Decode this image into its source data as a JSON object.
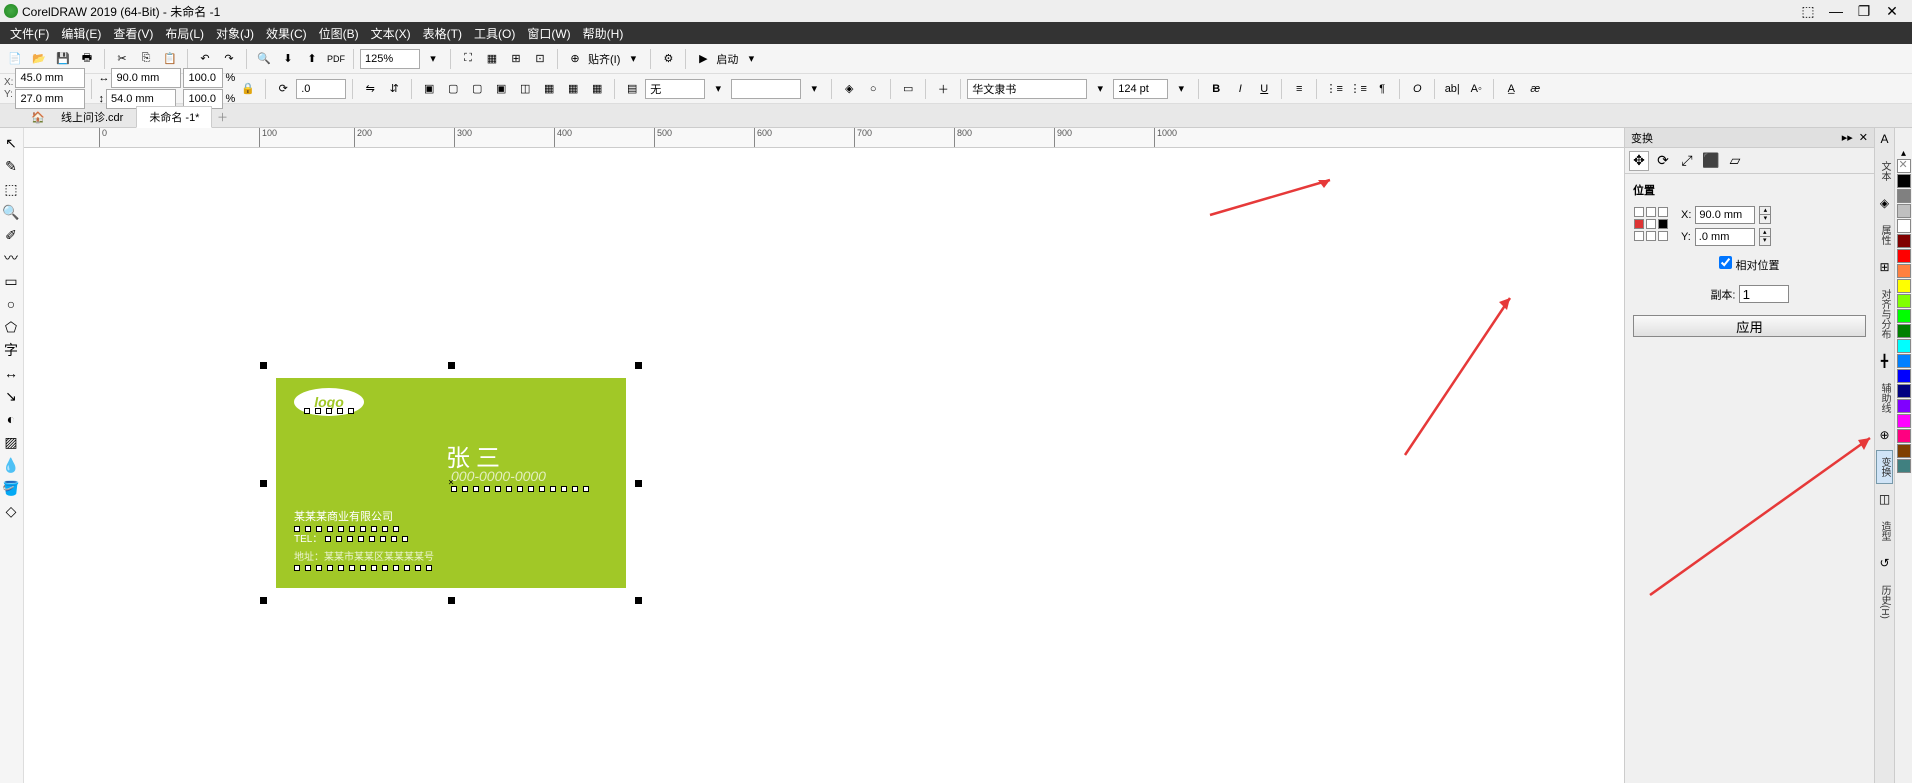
{
  "app": {
    "title": "CorelDRAW 2019 (64-Bit) - 未命名 -1"
  },
  "menu": {
    "file": "文件(F)",
    "edit": "编辑(E)",
    "view": "查看(V)",
    "layout": "布局(L)",
    "object": "对象(J)",
    "effects": "效果(C)",
    "bitmap": "位图(B)",
    "text": "文本(X)",
    "table": "表格(T)",
    "tools": "工具(O)",
    "window": "窗口(W)",
    "help": "帮助(H)"
  },
  "toolbar1": {
    "zoom": "125%",
    "align_label": "贴齐(I)",
    "launch_label": "启动"
  },
  "propbar": {
    "x_label": "X:",
    "y_label": "Y:",
    "x_val": "45.0 mm",
    "y_val": "27.0 mm",
    "w_val": "90.0 mm",
    "h_val": "54.0 mm",
    "scale_x": "100.0",
    "scale_y": "100.0",
    "pct": "%",
    "rotation": ".0",
    "fill_label": "无",
    "font_name": "华文隶书",
    "font_size": "124 pt"
  },
  "tabs": {
    "doc1": "线上问诊.cdr",
    "doc2": "未命名 -1*"
  },
  "ruler": {
    "t0": "0",
    "t100": "100",
    "t200": "200",
    "t300": "300",
    "t400": "400",
    "t500": "500",
    "t600": "600",
    "t700": "700",
    "t800": "800",
    "t900": "900",
    "t1000": "1000"
  },
  "card": {
    "logo": "logo",
    "name": "张 三",
    "phone": "000-0000-0000",
    "company": "某某某商业有限公司",
    "phone2": "TEL：",
    "addr": "地址：某某市某某区某某某某号"
  },
  "docker": {
    "title": "变换",
    "section": "位置",
    "x_lbl": "X:",
    "x_val": "90.0 mm",
    "y_lbl": "Y:",
    "y_val": ".0 mm",
    "relative": "相对位置",
    "copies_lbl": "副本:",
    "copies_val": "1",
    "apply": "应用"
  },
  "side": {
    "text": "文本",
    "properties": "属性",
    "align": "对齐与分布",
    "guidelines": "辅助线",
    "transform": "变换",
    "reshape": "造型",
    "history": "历史(H)"
  },
  "colors": [
    "#000000",
    "#808080",
    "#c0c0c0",
    "#ffffff",
    "#800000",
    "#ff0000",
    "#ff8040",
    "#ffff00",
    "#80ff00",
    "#00ff00",
    "#008000",
    "#00ffff",
    "#0080ff",
    "#0000ff",
    "#000080",
    "#8000ff",
    "#ff00ff",
    "#ff0080",
    "#804000",
    "#408080"
  ]
}
